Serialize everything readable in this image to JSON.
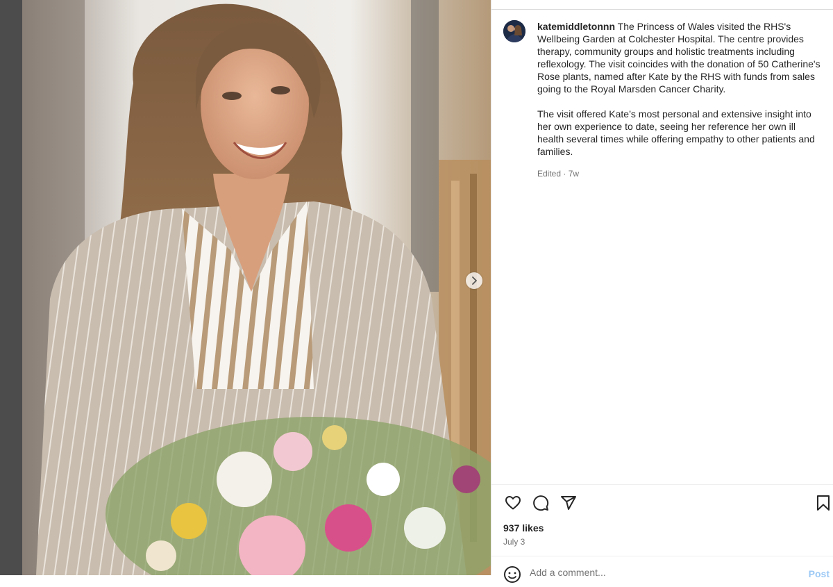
{
  "post": {
    "username": "katemiddletonnn",
    "caption_paragraph_1": "The Princess of Wales visited the RHS's Wellbeing Garden at Colchester Hospital. The centre provides therapy, community groups and holistic treatments including reflexology. The visit coincides with the donation of 50 Catherine's Rose plants, named after Kate by the RHS with funds from sales going to the Royal Marsden Cancer Charity.",
    "caption_paragraph_2": "The visit offered Kate’s most personal and extensive insight into her own experience to date, seeing her reference her own ill health several times while offering empathy to other patients and families.",
    "edited_label": "Edited",
    "time_ago": "7w",
    "likes": "937 likes",
    "date": "July 3"
  },
  "comment": {
    "placeholder": "Add a comment...",
    "post_label": "Post"
  },
  "icons": {
    "like": "heart-icon",
    "comment": "comment-icon",
    "share": "send-icon",
    "save": "bookmark-icon",
    "emoji": "emoji-icon",
    "next": "chevron-right-icon"
  }
}
